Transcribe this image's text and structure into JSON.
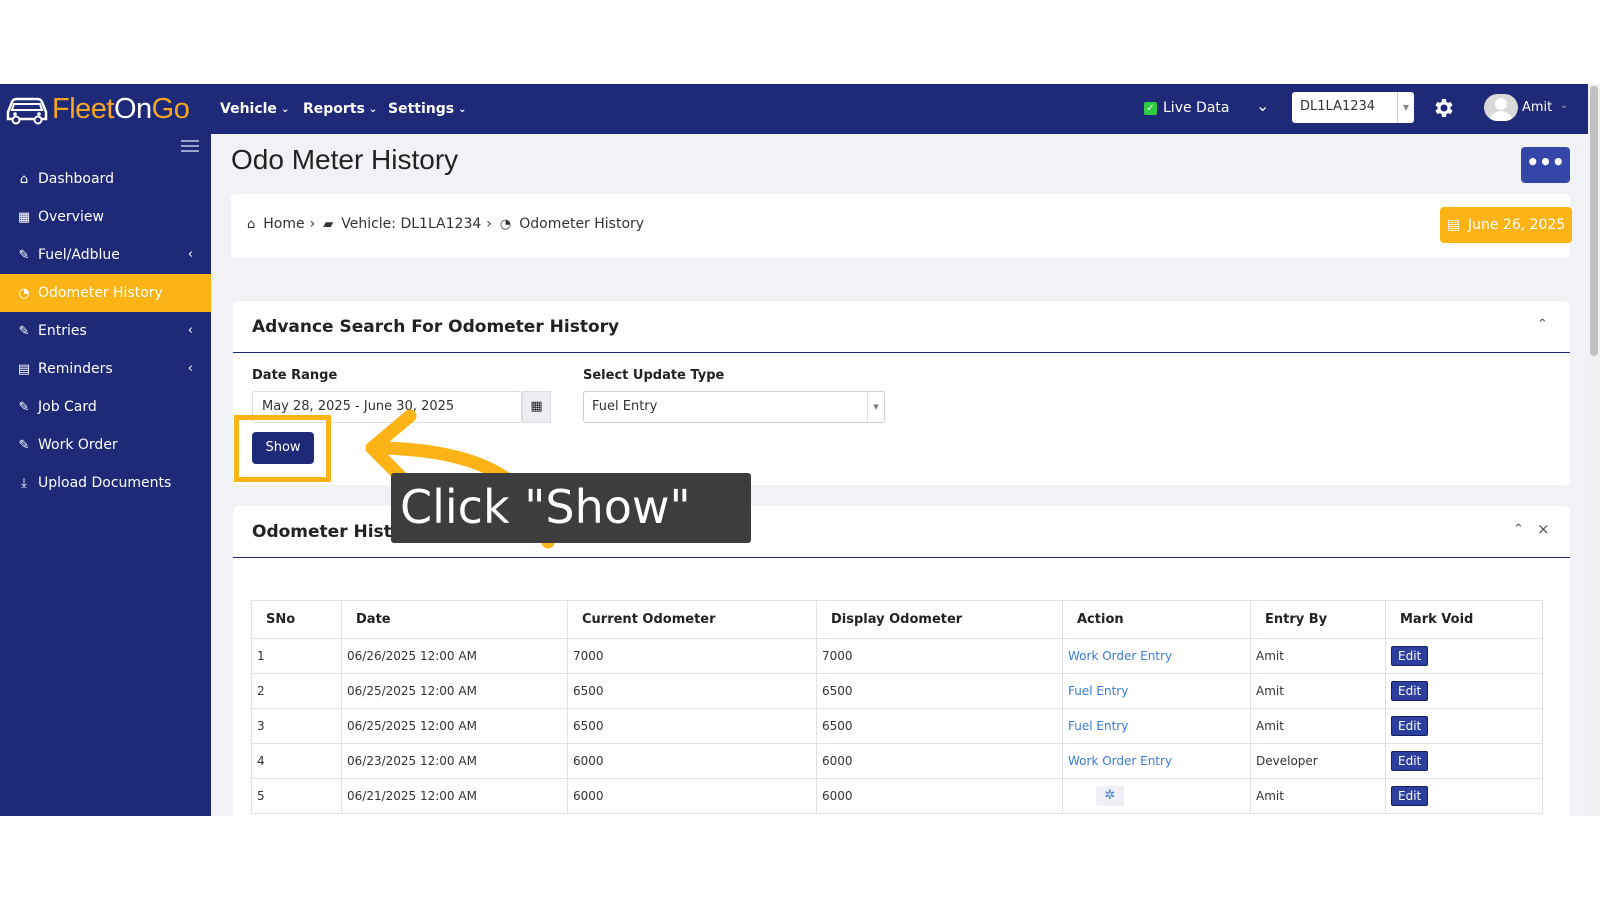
{
  "app": {
    "logo_text_1": "Fleet",
    "logo_text_2": "On",
    "logo_text_3": "Go"
  },
  "topnav": {
    "menus": [
      {
        "label": "Vehicle"
      },
      {
        "label": "Reports"
      },
      {
        "label": "Settings"
      }
    ],
    "live_data_label": "Live Data",
    "vehicle_selected": "DL1LA1234",
    "user_name": "Amit"
  },
  "sidebar": {
    "items": [
      {
        "label": "Dashboard",
        "icon": "home-icon"
      },
      {
        "label": "Overview",
        "icon": "grid-icon"
      },
      {
        "label": "Fuel/Adblue",
        "icon": "edit-icon",
        "has_children": true
      },
      {
        "label": "Odometer History",
        "icon": "dashboard-gauge-icon",
        "active": true
      },
      {
        "label": "Entries",
        "icon": "edit-icon",
        "has_children": true
      },
      {
        "label": "Reminders",
        "icon": "calendar-icon",
        "has_children": true
      },
      {
        "label": "Job Card",
        "icon": "edit-icon"
      },
      {
        "label": "Work Order",
        "icon": "edit-icon"
      },
      {
        "label": "Upload Documents",
        "icon": "download-icon"
      }
    ]
  },
  "page": {
    "title": "Odo Meter History",
    "more_button": "•••",
    "breadcrumbs": [
      "Home",
      "Vehicle: DL1LA1234",
      "Odometer History"
    ],
    "date_badge": "June 26, 2025"
  },
  "search": {
    "title": "Advance Search For Odometer History",
    "date_range_label": "Date Range",
    "date_range_value": "May 28, 2025 - June 30, 2025",
    "update_type_label": "Select Update Type",
    "update_type_value": "Fuel Entry",
    "show_button": "Show"
  },
  "history": {
    "title": "Odometer History",
    "columns": [
      "SNo",
      "Date",
      "Current Odometer",
      "Display Odometer",
      "Action",
      "Entry By",
      "Mark Void"
    ],
    "rows": [
      {
        "sno": "1",
        "date": "06/26/2025 12:00 AM",
        "current": "7000",
        "display": "7000",
        "action": "Work Order Entry",
        "entry_by": "Amit",
        "void": "Edit"
      },
      {
        "sno": "2",
        "date": "06/25/2025 12:00 AM",
        "current": "6500",
        "display": "6500",
        "action": "Fuel Entry",
        "entry_by": "Amit",
        "void": "Edit"
      },
      {
        "sno": "3",
        "date": "06/25/2025 12:00 AM",
        "current": "6500",
        "display": "6500",
        "action": "Fuel Entry",
        "entry_by": "Amit",
        "void": "Edit"
      },
      {
        "sno": "4",
        "date": "06/23/2025 12:00 AM",
        "current": "6000",
        "display": "6000",
        "action": "Work Order Entry",
        "entry_by": "Developer",
        "void": "Edit"
      },
      {
        "sno": "5",
        "date": "06/21/2025 12:00 AM",
        "current": "6000",
        "display": "6000",
        "action": "",
        "entry_by": "Amit",
        "void": "Edit"
      }
    ]
  },
  "annotation": {
    "text": "Click \"Show\""
  },
  "colors": {
    "nav": "#1e2a78",
    "accent": "#fbb316",
    "link": "#3a7bd5"
  }
}
